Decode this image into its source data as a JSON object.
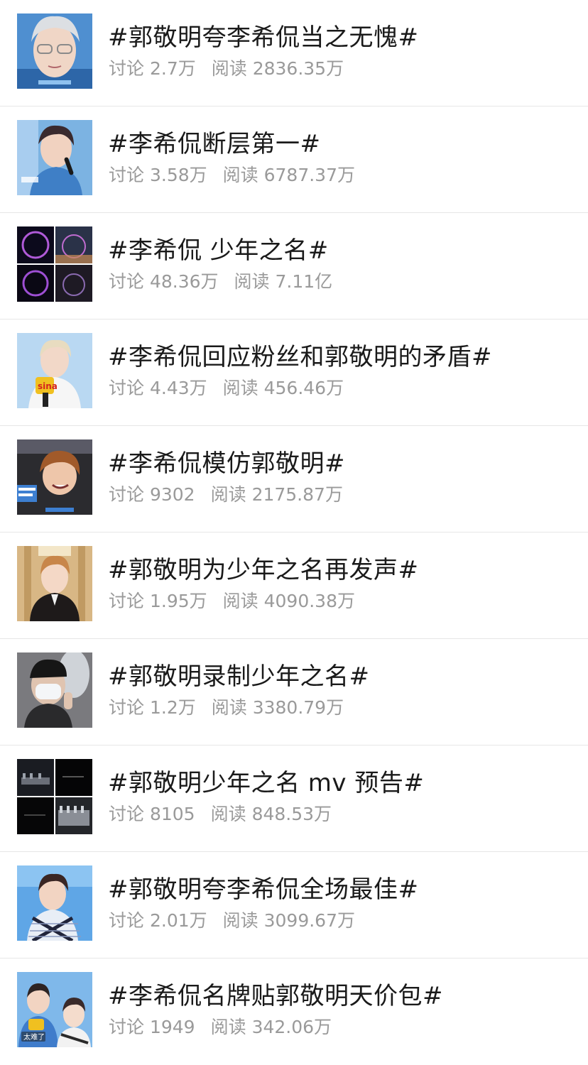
{
  "topics": [
    {
      "title": "#郭敬明夸李希侃当之无愧#",
      "discuss_label": "讨论",
      "discuss": "2.7万",
      "read_label": "阅读",
      "read": "2836.35万",
      "thumb": "stage-closeup-silver-hair"
    },
    {
      "title": "#李希侃断层第一#",
      "discuss_label": "讨论",
      "discuss": "3.58万",
      "read_label": "阅读",
      "read": "6787.37万",
      "thumb": "stage-microphone"
    },
    {
      "title": "#李希侃 少年之名#",
      "discuss_label": "讨论",
      "discuss": "48.36万",
      "read_label": "阅读",
      "read": "7.11亿",
      "thumb": "ferris-wheel-grid"
    },
    {
      "title": "#李希侃回应粉丝和郭敬明的矛盾#",
      "discuss_label": "讨论",
      "discuss": "4.43万",
      "read_label": "阅读",
      "read": "456.46万",
      "thumb": "interview-sina-mic"
    },
    {
      "title": "#李希侃模仿郭敬明#",
      "discuss_label": "讨论",
      "discuss": "9302",
      "read_label": "阅读",
      "read": "2175.87万",
      "thumb": "laughing-audience"
    },
    {
      "title": "#郭敬明为少年之名再发声#",
      "discuss_label": "讨论",
      "discuss": "1.95万",
      "read_label": "阅读",
      "read": "4090.38万",
      "thumb": "portrait-corridor"
    },
    {
      "title": "#郭敬明录制少年之名#",
      "discuss_label": "讨论",
      "discuss": "1.2万",
      "read_label": "阅读",
      "read": "3380.79万",
      "thumb": "masked-selfie"
    },
    {
      "title": "#郭敬明少年之名 mv 预告#",
      "discuss_label": "讨论",
      "discuss": "8105",
      "read_label": "阅读",
      "read": "848.53万",
      "thumb": "dark-mv-grid"
    },
    {
      "title": "#郭敬明夸李希侃全场最佳#",
      "discuss_label": "讨论",
      "discuss": "2.01万",
      "read_label": "阅读",
      "read": "3099.67万",
      "thumb": "striped-shirt-stage"
    },
    {
      "title": "#李希侃名牌贴郭敬明天价包#",
      "discuss_label": "讨论",
      "discuss": "1949",
      "read_label": "阅读",
      "read": "342.06万",
      "thumb": "two-person-sina"
    }
  ],
  "thumb_captions": {
    "interview_logo": "sina",
    "two_person_caption": "太难了"
  }
}
